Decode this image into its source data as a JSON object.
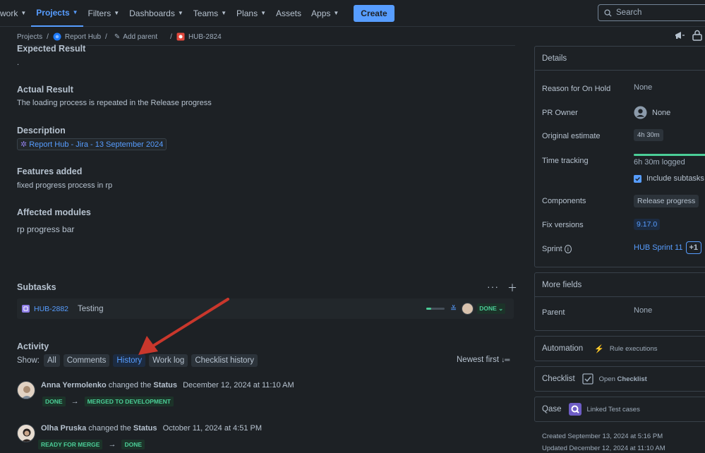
{
  "nav": {
    "items": [
      {
        "label": "work",
        "active": false
      },
      {
        "label": "Projects",
        "active": true
      },
      {
        "label": "Filters",
        "active": false
      },
      {
        "label": "Dashboards",
        "active": false
      },
      {
        "label": "Teams",
        "active": false
      },
      {
        "label": "Plans",
        "active": false
      },
      {
        "label": "Assets",
        "active": false
      },
      {
        "label": "Apps",
        "active": false
      }
    ],
    "create_label": "Create",
    "search_placeholder": "Search"
  },
  "breadcrumb": {
    "projects": "Projects",
    "project": "Report Hub",
    "add_parent": "Add parent",
    "issue_key": "HUB-2824"
  },
  "issue": {
    "expected_result_label": "Expected Result",
    "expected_result_value": ".",
    "actual_result_label": "Actual Result",
    "actual_result_value": "The loading process is repeated in the Release progress",
    "description_label": "Description",
    "description_link": "Report Hub - Jira - 13 September 2024",
    "features_label": "Features added",
    "features_value": "fixed progress process in rp",
    "affected_label": "Affected modules",
    "affected_value": "rp progress bar"
  },
  "subtasks": {
    "title": "Subtasks",
    "items": [
      {
        "key": "HUB-2882",
        "summary": "Testing",
        "status": "DONE",
        "progress": 0.25
      }
    ]
  },
  "activity": {
    "title": "Activity",
    "show_label": "Show:",
    "filters": [
      "All",
      "Comments",
      "History",
      "Work log",
      "Checklist history"
    ],
    "active_filter": "History",
    "sort_label": "Newest first",
    "history": [
      {
        "user": "Anna Yermolenko",
        "action": "changed the",
        "field": "Status",
        "date": "December 12, 2024 at 11:10 AM",
        "from": "DONE",
        "to": "MERGED TO DEVELOPMENT"
      },
      {
        "user": "Olha Pruska",
        "action": "changed the",
        "field": "Status",
        "date": "October 11, 2024 at 4:51 PM",
        "from": "READY FOR MERGE",
        "to": "DONE"
      }
    ]
  },
  "details": {
    "title": "Details",
    "reason_label": "Reason for On Hold",
    "reason_value": "None",
    "pr_owner_label": "PR Owner",
    "pr_owner_value": "None",
    "estimate_label": "Original estimate",
    "estimate_value": "4h 30m",
    "time_tracking_label": "Time tracking",
    "time_logged": "6h 30m logged",
    "include_subtasks": "Include subtasks",
    "components_label": "Components",
    "components_value": "Release progress",
    "fix_versions_label": "Fix versions",
    "fix_versions_value": "9.17.0",
    "sprint_label": "Sprint",
    "sprint_value": "HUB Sprint 11",
    "sprint_more": "+1"
  },
  "more_fields": {
    "title": "More fields",
    "parent_label": "Parent",
    "parent_value": "None"
  },
  "automation": {
    "title": "Automation",
    "sub": "Rule executions"
  },
  "checklist": {
    "title": "Checklist",
    "sub_prefix": "Open",
    "sub_bold": "Checklist"
  },
  "qase": {
    "title": "Qase",
    "sub": "Linked Test cases"
  },
  "meta": {
    "created": "Created September 13, 2024 at 5:16 PM",
    "updated": "Updated December 12, 2024 at 11:10 AM"
  },
  "colors": {
    "accent": "#579dff",
    "done": "#4bce97",
    "annotation_arrow": "#c9372c"
  }
}
